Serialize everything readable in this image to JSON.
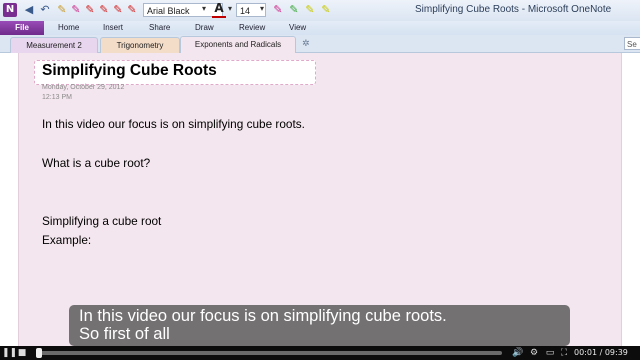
{
  "window": {
    "title": "Simplifying Cube Roots - Microsoft OneNote",
    "app_icon_letter": "N"
  },
  "quick_access": {
    "font_name": "Arial Black",
    "font_size": "14",
    "font_color_glyph": "A",
    "icons": [
      "back-icon",
      "undo-icon",
      "pen-icons",
      "highlighter-icons"
    ]
  },
  "ribbon": {
    "file": "File",
    "tabs": [
      "Home",
      "Insert",
      "Share",
      "Draw",
      "Review",
      "View"
    ]
  },
  "sections": {
    "tabs": [
      "Measurement 2",
      "Trigonometry",
      "Exponents and Radicals"
    ],
    "active": "Exponents and Radicals",
    "search_value": "Se"
  },
  "page": {
    "title": "Simplifying Cube Roots",
    "date": "Monday, October 29, 2012",
    "time": "12:13 PM",
    "lines": [
      "In this video our focus is on simplifying cube roots.",
      "What is a cube root?",
      "Simplifying a cube root",
      "Example:"
    ]
  },
  "subtitle": {
    "line1": "In this video our focus is on simplifying cube roots.",
    "line2": "So first of all"
  },
  "player": {
    "time_display": "00:01 / 09:39",
    "progress_fraction": 0.002
  },
  "colors": {
    "file_tab": "#7b3296",
    "page_background": "#f4e6ee",
    "title_border": "#e0a9c9"
  }
}
